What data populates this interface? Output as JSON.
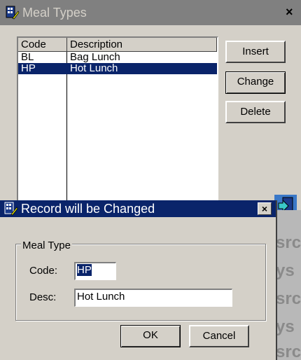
{
  "main_window": {
    "title": "Meal Types",
    "close_glyph": "×",
    "columns": [
      "Code",
      "Description"
    ],
    "rows": [
      {
        "code": "BL",
        "description": "Bag Lunch",
        "selected": false
      },
      {
        "code": "HP",
        "description": "Hot Lunch",
        "selected": true
      }
    ],
    "buttons": {
      "insert": "Insert",
      "change": "Change",
      "delete": "Delete"
    }
  },
  "dialog": {
    "title": "Record will be Changed",
    "close_glyph": "×",
    "group_label": "Meal Type",
    "code_label": "Code:",
    "code_value": "HP",
    "desc_label": "Desc:",
    "desc_value": "Hot Lunch",
    "ok_label": "OK",
    "cancel_label": "Cancel"
  },
  "icons": {
    "main_title_icon": "app-icon",
    "dialog_title_icon": "edit-icon",
    "exit_icon": "door-icon"
  }
}
